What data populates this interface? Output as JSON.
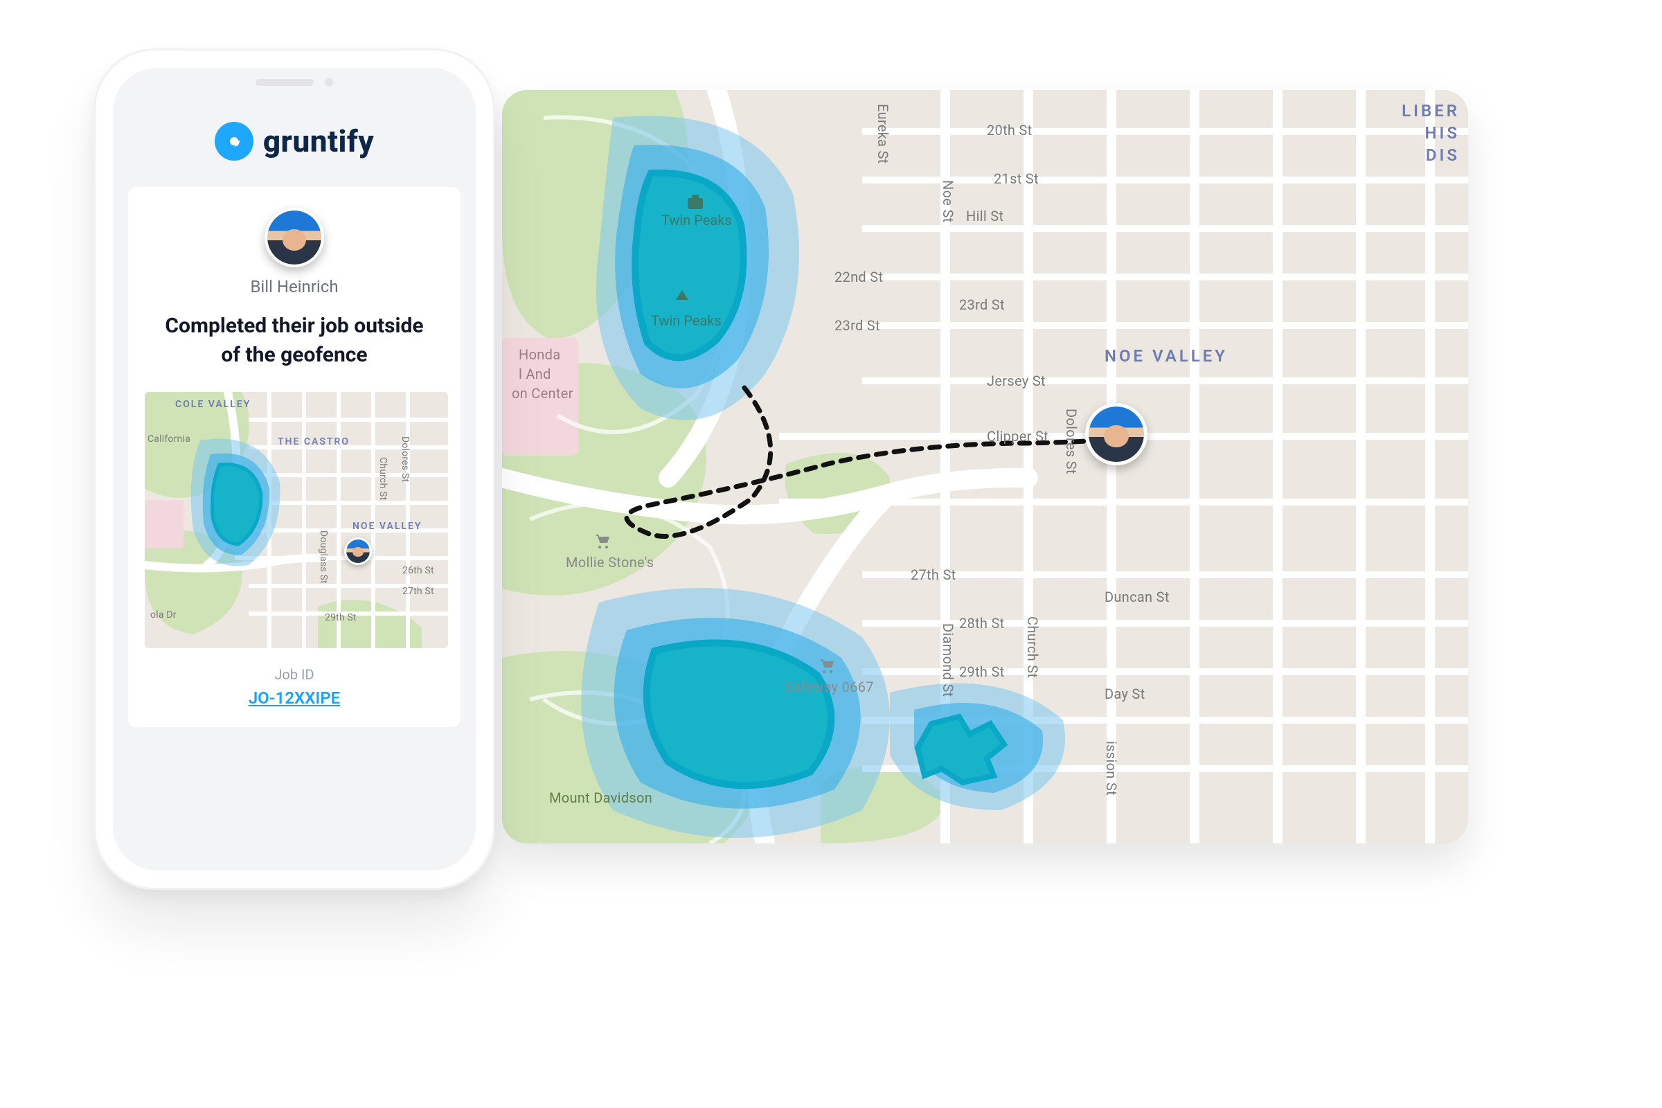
{
  "brand": {
    "name": "gruntify"
  },
  "notification": {
    "user_name": "Bill Heinrich",
    "message_line1": "Completed their job outside",
    "message_line2": "of the geofence",
    "job_id_label": "Job ID",
    "job_id": "JO-12XXIPE"
  },
  "mini_map": {
    "labels": {
      "cole_valley": "COLE VALLEY",
      "the_castro": "THE CASTRO",
      "noe_valley": "NOE VALLEY",
      "california": "California",
      "dolores": "Dolores St",
      "church": "Church St",
      "douglass": "Douglass St",
      "st26": "26th St",
      "st27": "27th St",
      "st29": "29th St",
      "ola": "ola Dr"
    }
  },
  "big_map": {
    "labels": {
      "noe_valley": "NOE VALLEY",
      "liber": "LIBER",
      "his": "HIS",
      "dis": "DIS",
      "eureka": "Eureka St",
      "noe": "Noe St",
      "diamond": "Diamond St",
      "church": "Church St",
      "dolores": "Dolores St",
      "mission": "ission St",
      "st20": "20th St",
      "st21": "21st St",
      "hill": "Hill St",
      "st22": "22nd St",
      "st23": "23rd St",
      "st23b": "23rd St",
      "jersey": "Jersey St",
      "clipper": "Clipper St",
      "st27": "27th St",
      "duncan": "Duncan St",
      "st28": "28th St",
      "st29": "29th St",
      "day": "Day St",
      "twin_peaks": "Twin Peaks",
      "twin_peaks2": "Twin Peaks",
      "honda": "Honda",
      "land": "l And",
      "center": "on Center",
      "mollie": "Mollie Stone's",
      "safeway": "Safeway 0667",
      "mount_davidson": "Mount Davidson"
    }
  }
}
